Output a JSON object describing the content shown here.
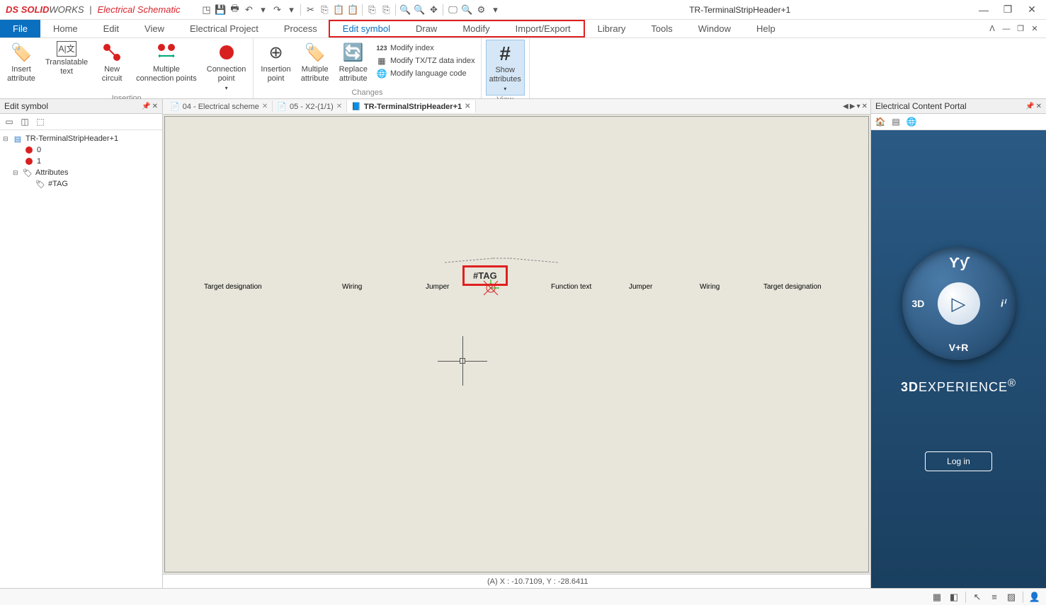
{
  "app": {
    "brand_ds": "DS",
    "brand_solid": "SOLID",
    "brand_works": "WORKS",
    "divider": "|",
    "product": "Electrical Schematic",
    "document_title": "TR-TerminalStripHeader+1"
  },
  "menu": {
    "file": "File",
    "items": [
      "Home",
      "Edit",
      "View",
      "Electrical Project",
      "Process",
      "Edit symbol",
      "Draw",
      "Modify",
      "Import/Export",
      "Library",
      "Tools",
      "Window",
      "Help"
    ]
  },
  "ribbon": {
    "groups": {
      "insertion": {
        "label": "Insertion",
        "buttons": {
          "insert_attribute": "Insert\nattribute",
          "translatable_text": "Translatable\ntext",
          "new_circuit": "New\ncircuit",
          "multiple_cp": "Multiple\nconnection points",
          "connection_point": "Connection\npoint"
        }
      },
      "changes": {
        "label": "Changes",
        "buttons": {
          "insertion_point": "Insertion\npoint",
          "multiple_attribute": "Multiple\nattribute",
          "replace_attribute": "Replace\nattribute"
        },
        "small": {
          "modify_index": "Modify index",
          "modify_txtz": "Modify TX/TZ data index",
          "modify_lang": "Modify language code"
        }
      },
      "view": {
        "label": "View",
        "buttons": {
          "show_attributes": "Show\nattributes"
        }
      }
    }
  },
  "left_panel": {
    "title": "Edit symbol",
    "tree": {
      "root": "TR-TerminalStripHeader+1",
      "node0": "0",
      "node1": "1",
      "attributes": "Attributes",
      "tag": "#TAG"
    }
  },
  "tabs": {
    "t1": "04 - Electrical scheme",
    "t2": "05 - X2-(1/1)",
    "t3": "TR-TerminalStripHeader+1"
  },
  "canvas": {
    "labels": {
      "target_designation_l": "Target designation",
      "wiring_l": "Wiring",
      "jumper_l": "Jumper",
      "tag": "#TAG",
      "function_text": "Function text",
      "jumper_r": "Jumper",
      "wiring_r": "Wiring",
      "target_designation_r": "Target designation"
    }
  },
  "status": {
    "coords": "(A) X : -10.7109, Y : -28.6411"
  },
  "right_panel": {
    "title": "Electrical Content Portal",
    "compass": {
      "top": "Ƴƴ",
      "left": "3D",
      "right": "iⁱ",
      "bottom": "V+R",
      "play": "▷"
    },
    "exp_3d": "3D",
    "exp_text": "EXPERIENCE",
    "exp_r": "®",
    "login": "Log in"
  }
}
